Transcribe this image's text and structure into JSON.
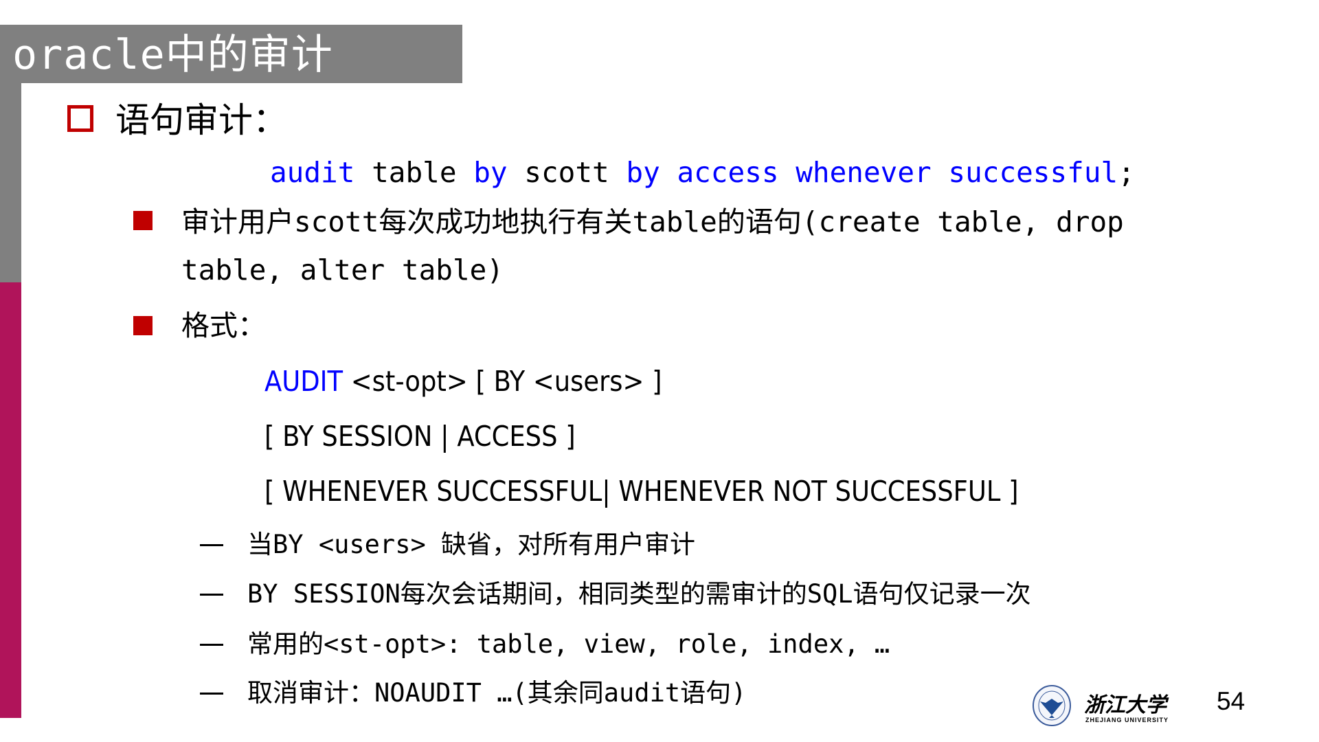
{
  "slide": {
    "title": "oracle中的审计",
    "page_number": "54",
    "colors": {
      "title_bar": "#808080",
      "accent_strip": "#B0145A",
      "bullet": "#C00000",
      "keyword": "#0000FF"
    }
  },
  "section": {
    "heading": "语句审计：",
    "example": {
      "parts": [
        {
          "text": "audit",
          "kind": "keyword"
        },
        {
          "text": " table ",
          "kind": "plain"
        },
        {
          "text": "by",
          "kind": "keyword"
        },
        {
          "text": " scott ",
          "kind": "plain"
        },
        {
          "text": "by access whenever successful",
          "kind": "keyword"
        },
        {
          "text": ";",
          "kind": "plain"
        }
      ]
    },
    "bullets": [
      {
        "line1": "审计用户scott每次成功地执行有关table的语句(create table, drop",
        "line2": "table, alter table)"
      },
      {
        "line1": "格式："
      }
    ],
    "format_lines": [
      {
        "keyword": "AUDIT",
        "rest": " <st-opt> [ BY <users> ]"
      },
      {
        "keyword": "",
        "rest": "[ BY SESSION | ACCESS ]"
      },
      {
        "keyword": "",
        "rest": "[ WHENEVER SUCCESSFUL| WHENEVER NOT SUCCESSFUL ]"
      }
    ],
    "notes": [
      "当BY <users> 缺省，对所有用户审计",
      "BY SESSION每次会话期间，相同类型的需审计的SQL语句仅记录一次",
      "常用的<st-opt>: table, view, role, index, …",
      "取消审计：NOAUDIT …(其余同audit语句)"
    ]
  },
  "logo": {
    "name_cn": "浙江大学",
    "name_en": "ZHEJIANG UNIVERSITY"
  }
}
